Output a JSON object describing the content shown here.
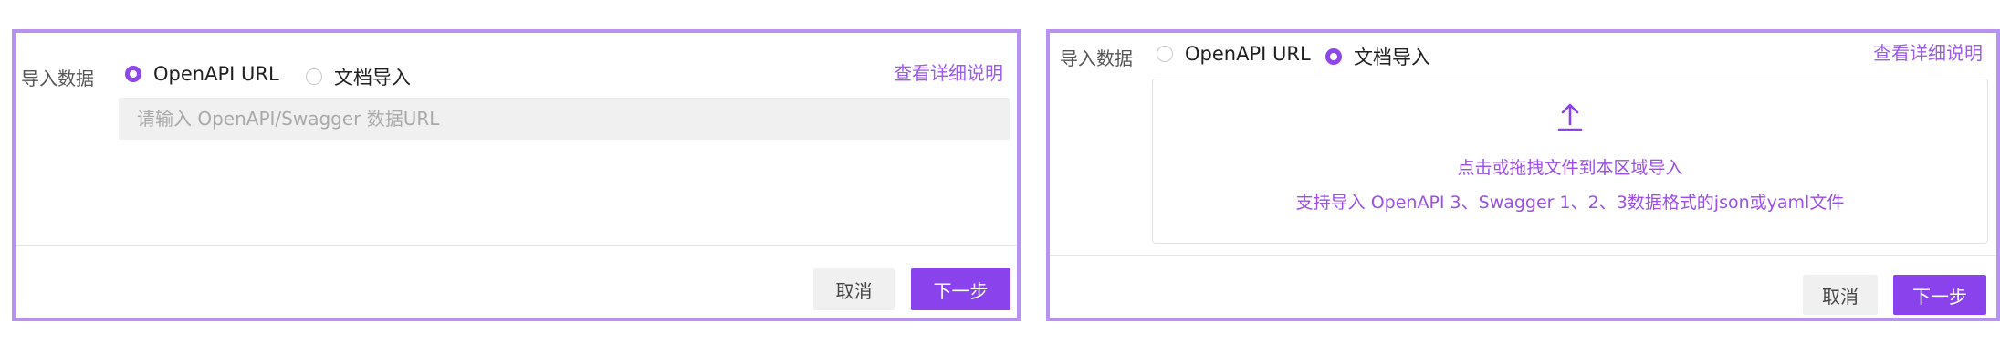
{
  "left_panel": {
    "import_label": "导入数据",
    "options": [
      {
        "label": "OpenAPI URL",
        "selected": true
      },
      {
        "label": "文档导入",
        "selected": false
      }
    ],
    "help_link": "查看详细说明",
    "url_input": {
      "value": "",
      "placeholder": "请输入 OpenAPI/Swagger 数据URL"
    },
    "cancel_label": "取消",
    "next_label": "下一步"
  },
  "right_panel": {
    "import_label": "导入数据",
    "options": [
      {
        "label": "OpenAPI URL",
        "selected": false
      },
      {
        "label": "文档导入",
        "selected": true
      }
    ],
    "help_link": "查看详细说明",
    "dropzone": {
      "icon": "upload-icon",
      "primary_text": "点击或拖拽文件到本区域导入",
      "secondary_text": "支持导入 OpenAPI 3、Swagger 1、2、3数据格式的json或yaml文件"
    },
    "cancel_label": "取消",
    "next_label": "下一步"
  },
  "colors": {
    "accent": "#8a43ec",
    "panel_border": "#b892f0",
    "link": "#9b5ce8",
    "input_bg": "#f0f0f1"
  }
}
